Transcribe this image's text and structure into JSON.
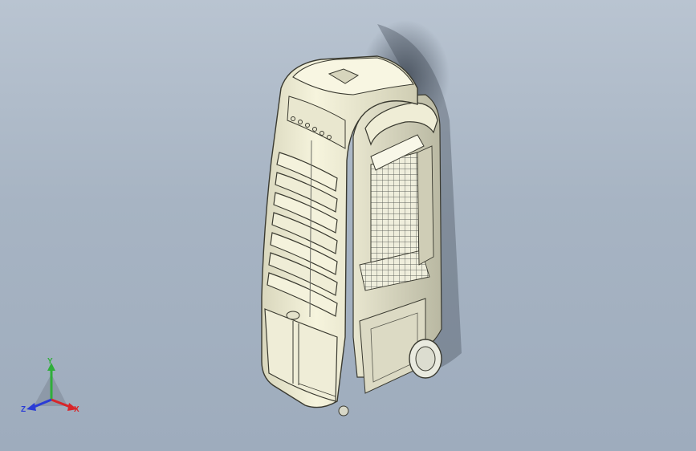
{
  "viewport": {
    "background_top": "#b9c4d1",
    "background_bottom": "#9eacbd"
  },
  "model": {
    "body_color": "#f3f1da",
    "edge_color": "#3a3a30",
    "grille_color": "#6b6d66",
    "wheel_color": "#e9eadf"
  },
  "triad": {
    "x_label": "X",
    "y_label": "Y",
    "z_label": "Z",
    "x_color": "#d8262a",
    "y_color": "#2fae3a",
    "z_color": "#2a3cd6"
  }
}
